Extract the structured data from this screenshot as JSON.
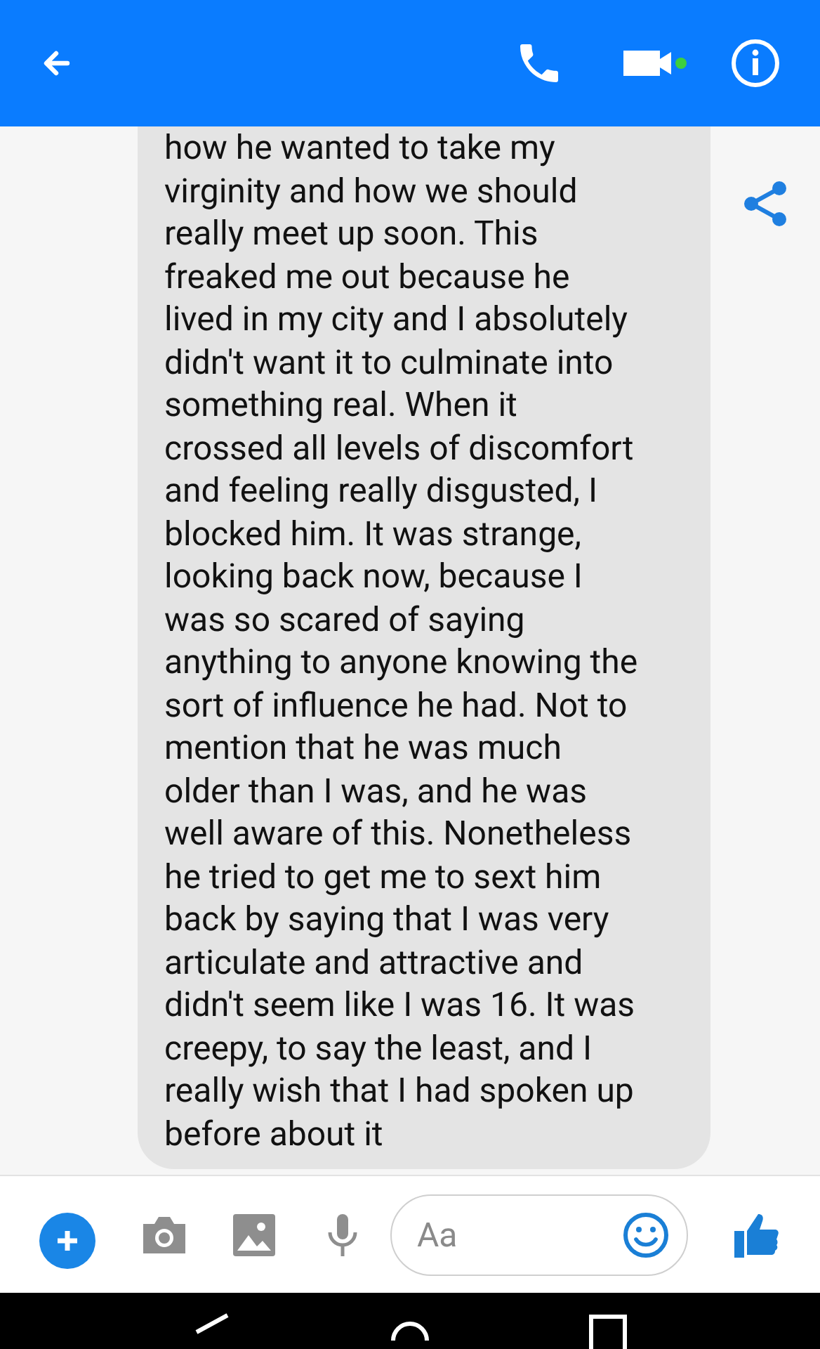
{
  "message": {
    "lines": [
      "how he wanted to take my",
      "virginity and how we should",
      "really meet up soon. This",
      "freaked me out because he",
      "lived in my city and I absolutely",
      "didn't want it to culminate into",
      "something real. When it",
      "crossed all levels of discomfort",
      "and feeling really disgusted, I",
      "blocked him. It was strange,",
      "looking back now, because I",
      "was so scared of saying",
      "anything to anyone knowing the",
      "sort of influence he had. Not to",
      "mention that he was much",
      "older than I was, and he was",
      "well aware of this. Nonetheless",
      "he tried to get me to sext him",
      "back by saying that I was very",
      "articulate and attractive and",
      "didn't seem like I was 16. It was",
      "creepy, to say the least, and I",
      "really wish that I had spoken up",
      "before about it"
    ]
  },
  "composer": {
    "placeholder": "Aa"
  }
}
